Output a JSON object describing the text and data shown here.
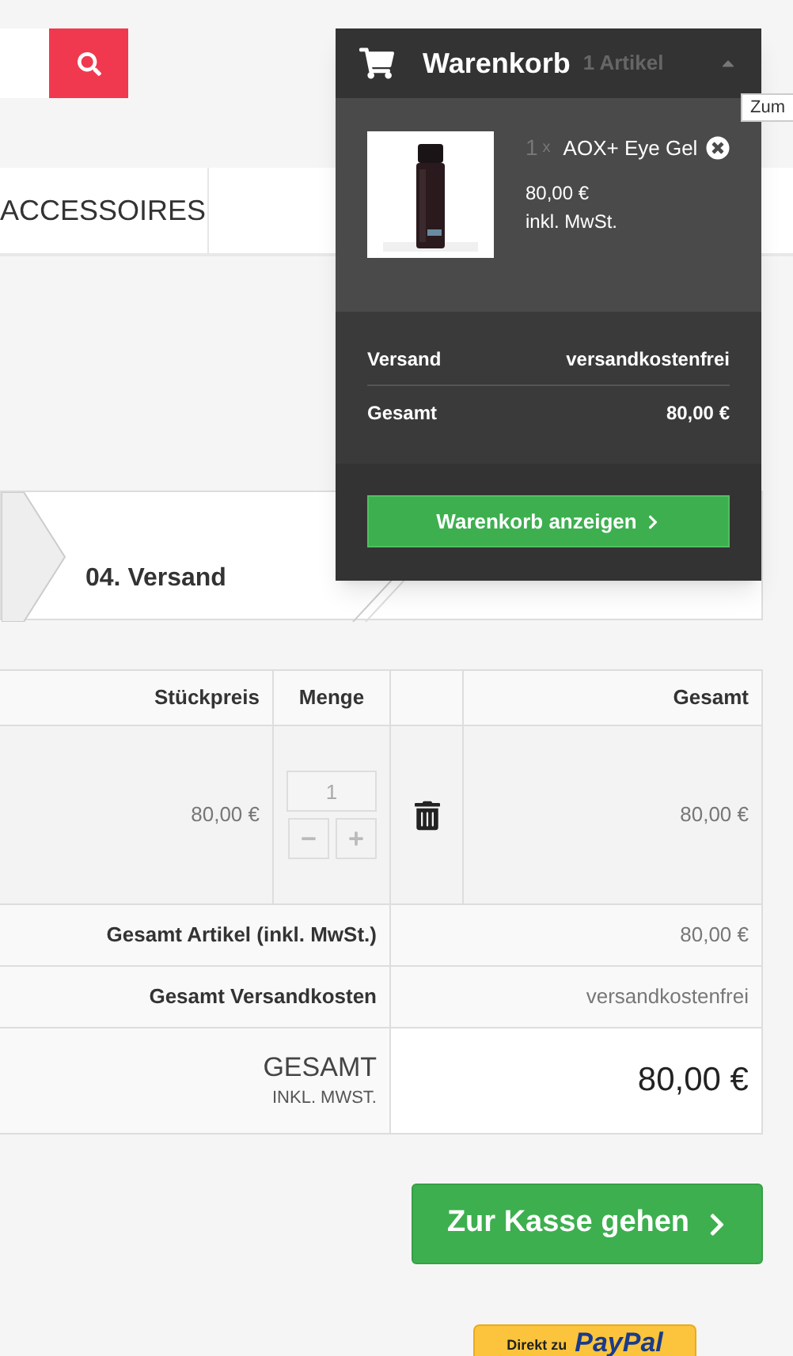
{
  "nav": {
    "items": [
      {
        "label": "ACCESSOIRES"
      }
    ]
  },
  "steps": [
    {
      "label": "04. Versand"
    }
  ],
  "table": {
    "columns": [
      "Stückpreis",
      "Menge",
      "Gesamt"
    ],
    "rows": [
      {
        "unit_price": "80,00 €",
        "quantity": "1",
        "total": "80,00 €"
      }
    ],
    "summary": [
      {
        "label": "Gesamt Artikel (inkl. MwSt.)",
        "value": "80,00 €"
      },
      {
        "label": "Gesamt Versandkosten",
        "value": "versandkostenfrei"
      }
    ],
    "grand_total": {
      "label": "GESAMT",
      "sublabel": "INKL. MWST.",
      "value": "80,00 €"
    }
  },
  "checkout_button": "Zur Kasse gehen",
  "paypal": {
    "prefix": "Direkt zu",
    "logo": "PayPal"
  },
  "cart": {
    "title": "Warenkorb",
    "count": "1 Artikel",
    "items": [
      {
        "quantity": "1",
        "times": "x",
        "name": "AOX+ Eye Gel",
        "price": "80,00 €",
        "tax_note": "inkl. MwSt."
      }
    ],
    "totals": [
      {
        "label": "Versand",
        "value": "versandkostenfrei"
      },
      {
        "label": "Gesamt",
        "value": "80,00 €"
      }
    ],
    "button": "Warenkorb anzeigen"
  },
  "tooltip": "Zum"
}
